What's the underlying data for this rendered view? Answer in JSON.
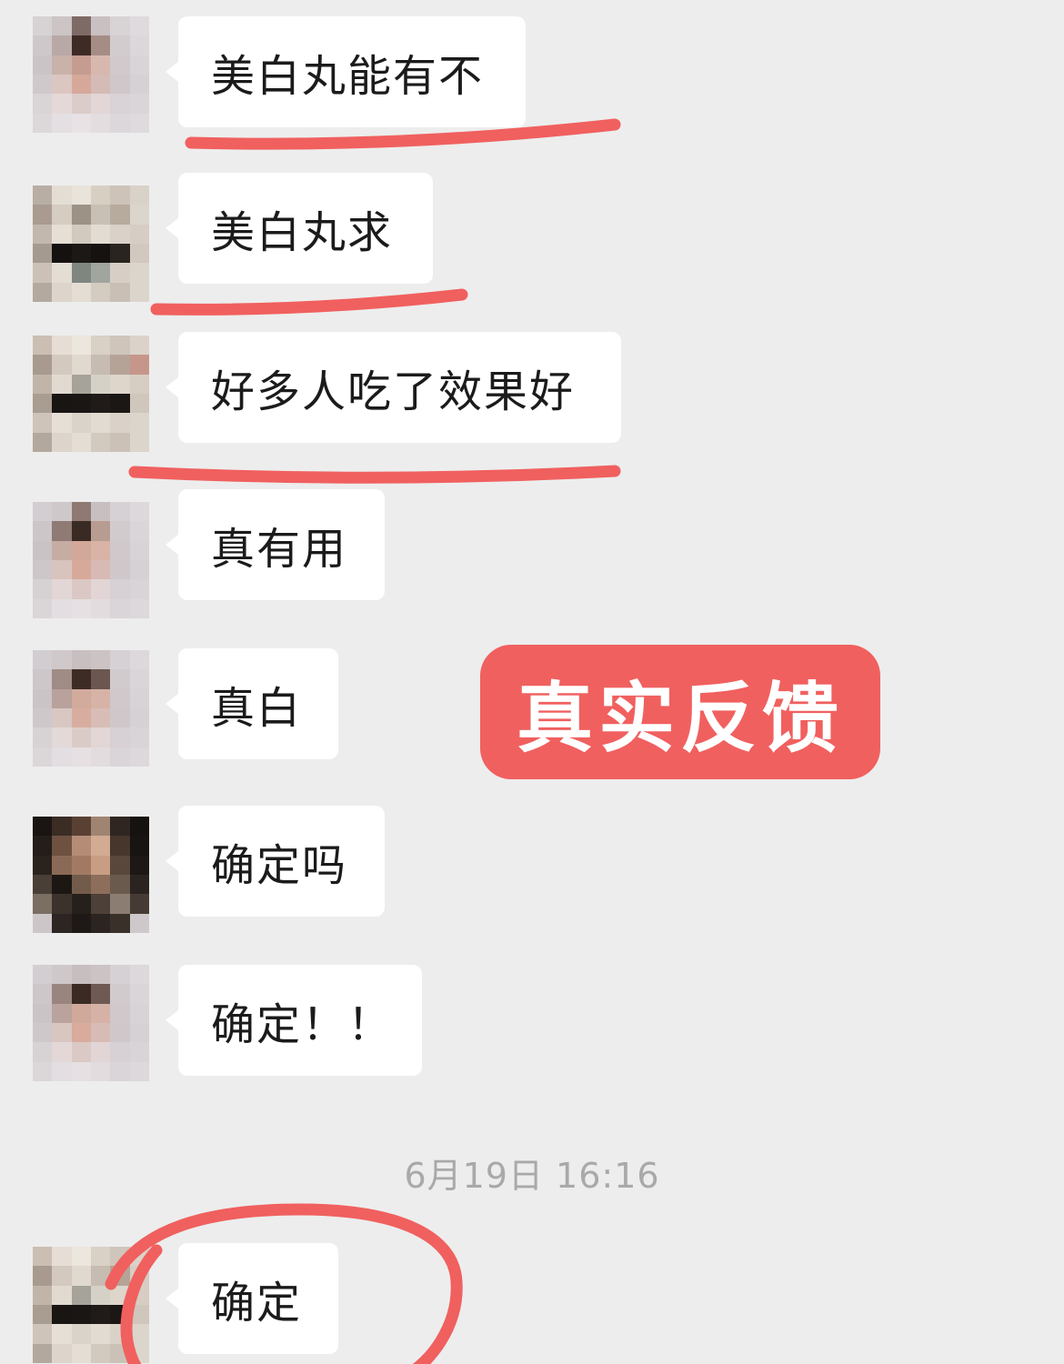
{
  "messages": [
    {
      "text": "美白丸能有不"
    },
    {
      "text": "美白丸求"
    },
    {
      "text": "好多人吃了效果好"
    },
    {
      "text": "真有用"
    },
    {
      "text": "真白"
    },
    {
      "text": "确定吗"
    },
    {
      "text": "确定！！"
    },
    {
      "text": "确定"
    }
  ],
  "timestamp": "6月19日 16:16",
  "badge": {
    "label": "真实反馈"
  },
  "colors": {
    "background": "#ededed",
    "bubble": "#ffffff",
    "annotation_red": "#f0605f",
    "timestamp_gray": "#a9a9a9"
  }
}
